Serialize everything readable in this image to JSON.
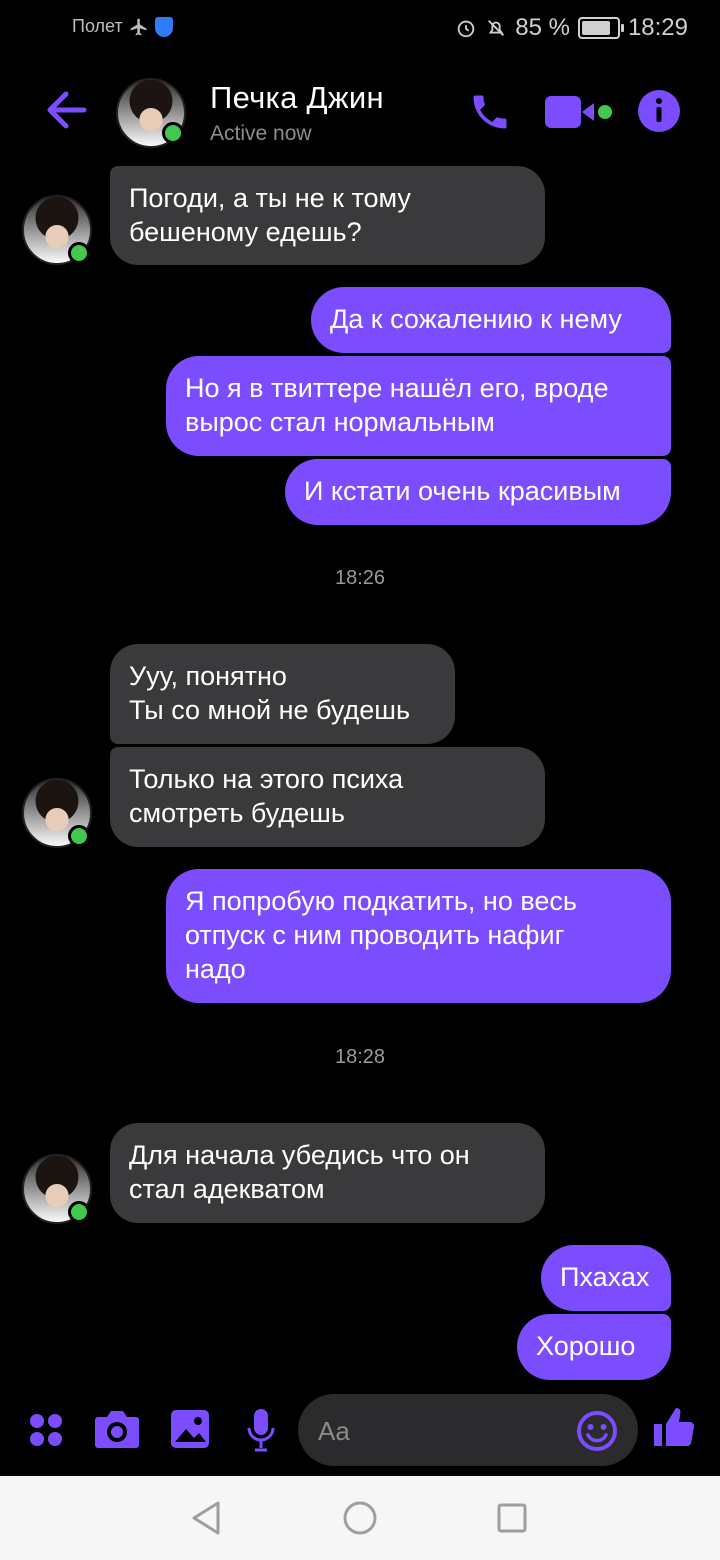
{
  "status_bar": {
    "carrier": "Полет",
    "battery": "85 %",
    "time": "18:29"
  },
  "header": {
    "contact_name": "Печка Джин",
    "contact_status": "Active now"
  },
  "messages": [
    {
      "text": "Погоди, а ты не к тому\nбешеному едешь?",
      "dir": "in"
    },
    {
      "text": "Да к сожалению к нему",
      "dir": "out"
    },
    {
      "text": "Но я в твиттере нашёл его, вроде\nвырос стал нормальным",
      "dir": "out"
    },
    {
      "text": "И кстати очень красивым",
      "dir": "out"
    },
    {
      "text": "Ууу, понятно\nТы со мной не будешь",
      "dir": "in"
    },
    {
      "text": "Только на этого психа\nсмотреть будешь",
      "dir": "in"
    },
    {
      "text": "Я попробую подкатить, но весь\nотпуск с ним проводить нафиг\nнадо",
      "dir": "out"
    },
    {
      "text": "Для начала убедись что он\nстал адекватом",
      "dir": "in"
    },
    {
      "text": "Пхахах",
      "dir": "out"
    },
    {
      "text": "Хорошо",
      "dir": "out"
    }
  ],
  "timestamps": [
    "18:26",
    "18:28"
  ],
  "composer": {
    "placeholder": "Aa"
  },
  "colors": {
    "accent": "#7c4dff",
    "incoming": "#3a3a3c",
    "online": "#43c74c",
    "background": "#000000"
  },
  "icons": [
    "back-arrow-icon",
    "phone-icon",
    "video-icon",
    "info-icon",
    "apps-icon",
    "camera-icon",
    "gallery-icon",
    "microphone-icon",
    "emoji-icon",
    "thumbs-up-icon",
    "nav-back-icon",
    "nav-home-icon",
    "nav-recents-icon"
  ]
}
